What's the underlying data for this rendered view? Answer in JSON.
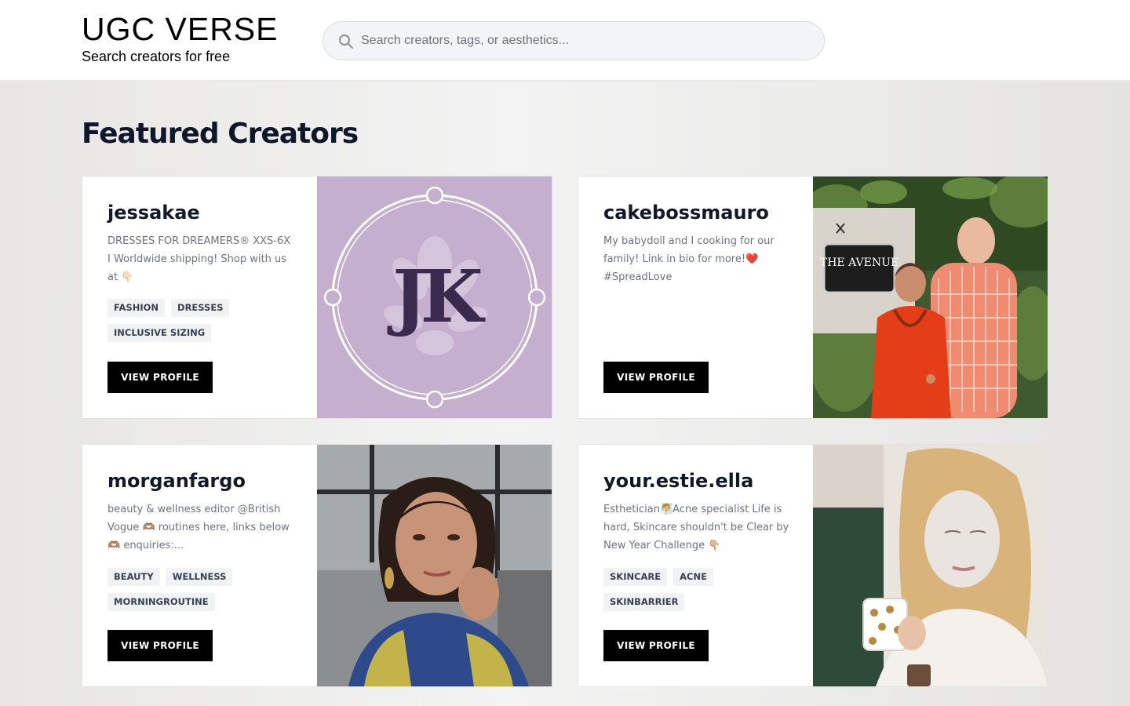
{
  "header": {
    "brand_title": "UGC VERSE",
    "brand_subtitle": "Search creators for free",
    "search_placeholder": "Search creators, tags, or aesthetics...",
    "search_value": ""
  },
  "main": {
    "section_title": "Featured Creators",
    "creators": [
      {
        "name": "jessakae",
        "bio": "DRESSES FOR DREAMERS® XXS-6X I Worldwide shipping! Shop with us at 👇🏻",
        "tags": [
          "FASHION",
          "DRESSES",
          "INCLUSIVE SIZING"
        ],
        "button_label": "VIEW PROFILE",
        "photo_icon": "jk-logo-image",
        "photo_logo_text": "JK"
      },
      {
        "name": "cakebossmauro",
        "bio": "My babydoll and I cooking for our family! Link in bio for more!❤️ #SpreadLove",
        "tags": [],
        "button_label": "VIEW PROFILE",
        "photo_icon": "couple-photo-image",
        "photo_sign_text": "THE AVENUE"
      },
      {
        "name": "morganfargo",
        "bio": "beauty & wellness editor @British Vogue 🫶🏽 routines here, links below 🫶🏽 enquiries:...",
        "tags": [
          "BEAUTY",
          "WELLNESS",
          "MORNINGROUTINE"
        ],
        "button_label": "VIEW PROFILE",
        "photo_icon": "portrait-photo-image"
      },
      {
        "name": "your.estie.ella",
        "bio": "Esthetician🧖🏼Acne specialist Life is hard, Skincare shouldn't be Clear by New Year Challenge 👇🏼",
        "tags": [
          "SKINCARE",
          "ACNE",
          "SKINBARRIER"
        ],
        "button_label": "VIEW PROFILE",
        "photo_icon": "face-mask-photo-image"
      }
    ]
  },
  "colors": {
    "button_bg": "#000000",
    "tag_bg": "#f1f2f4",
    "logo_bg": "#c4b0ce",
    "logo_letters": "#3a2a4d"
  }
}
